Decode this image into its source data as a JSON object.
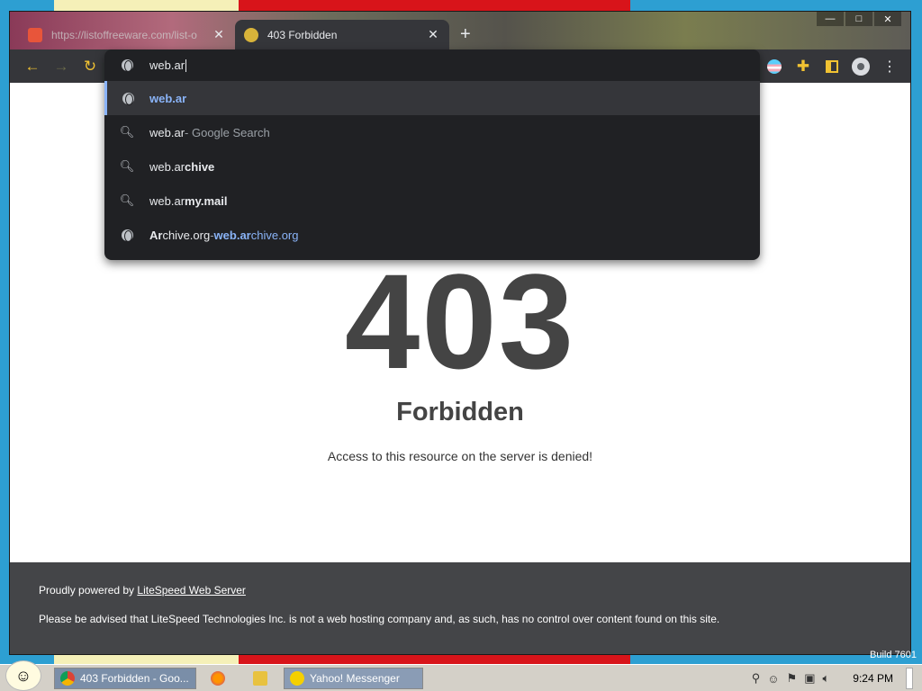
{
  "browser": {
    "tabs": [
      {
        "title": "https://listoffreeware.com/list-o",
        "active": false
      },
      {
        "title": "403 Forbidden",
        "active": true
      }
    ],
    "new_tab": "+",
    "window_controls": {
      "minimize": "—",
      "maximize": "□",
      "close": "✕"
    }
  },
  "omnibox": {
    "input": "web.ar",
    "suggestions": [
      {
        "type": "url",
        "main": "web.ar",
        "rest": "",
        "suffix": "",
        "url_main": "",
        "url_rest": ""
      },
      {
        "type": "search",
        "main": "web.ar",
        "rest": "",
        "suffix": " - Google Search",
        "url_main": "",
        "url_rest": ""
      },
      {
        "type": "search",
        "main": "web.ar",
        "rest": "chive",
        "suffix": "",
        "url_main": "",
        "url_rest": ""
      },
      {
        "type": "search",
        "main": "web.ar",
        "rest": "my.mail",
        "suffix": "",
        "url_main": "",
        "url_rest": ""
      },
      {
        "type": "url",
        "main": "Ar",
        "rest": "chive.org",
        "suffix": " - ",
        "url_main": "web.ar",
        "url_rest": "chive.org"
      }
    ]
  },
  "page": {
    "code": "403",
    "title": "Forbidden",
    "message": "Access to this resource on the server is denied!"
  },
  "footer": {
    "powered_prefix": "Proudly powered by ",
    "powered_link": "LiteSpeed Web Server",
    "advice": "Please be advised that LiteSpeed Technologies Inc. is not a web hosting company and, as such, has no control over content found on this site."
  },
  "taskbar": {
    "tasks": [
      "403 Forbidden - Goo...",
      "Yahoo! Messenger"
    ],
    "clock": "9:24 PM",
    "build": "Build 7601"
  }
}
